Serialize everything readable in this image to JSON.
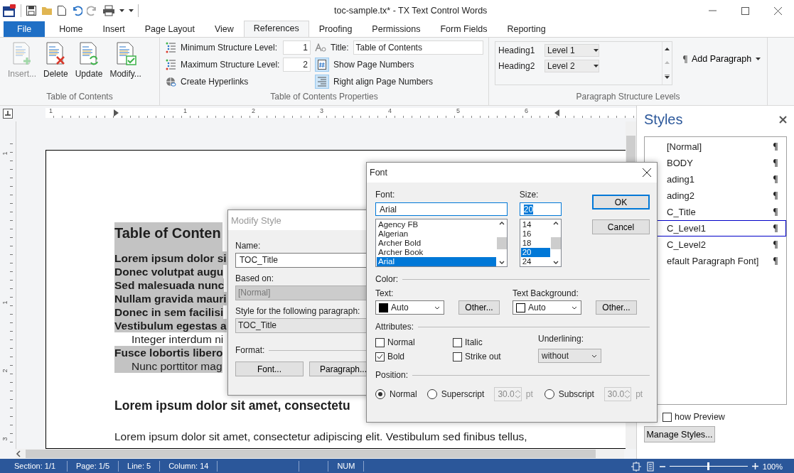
{
  "window": {
    "title": "toc-sample.tx* - TX Text Control Words"
  },
  "ribbon_tabs": [
    {
      "label": "File",
      "kind": "file",
      "selected": false
    },
    {
      "label": "Home",
      "kind": "tab",
      "selected": false
    },
    {
      "label": "Insert",
      "kind": "tab",
      "selected": false
    },
    {
      "label": "Page Layout",
      "kind": "tab",
      "selected": false
    },
    {
      "label": "View",
      "kind": "tab",
      "selected": false
    },
    {
      "label": "References",
      "kind": "tab",
      "selected": true
    },
    {
      "label": "Proofing",
      "kind": "tab",
      "selected": false
    },
    {
      "label": "Permissions",
      "kind": "tab",
      "selected": false
    },
    {
      "label": "Form Fields",
      "kind": "tab",
      "selected": false
    },
    {
      "label": "Reporting",
      "kind": "tab",
      "selected": false
    }
  ],
  "toc_group": {
    "label": "Table of Contents",
    "buttons": [
      {
        "label": "Insert...",
        "kind": "insert",
        "disabled": true
      },
      {
        "label": "Delete",
        "kind": "delete",
        "disabled": false
      },
      {
        "label": "Update",
        "kind": "update",
        "disabled": false
      },
      {
        "label": "Modify...",
        "kind": "modify",
        "disabled": false
      }
    ]
  },
  "properties_group": {
    "label": "Table of Contents Properties",
    "min_level": {
      "label": "Minimum Structure Level:",
      "value": "1"
    },
    "max_level": {
      "label": "Maximum Structure Level:",
      "value": "2"
    },
    "create_hyperlinks": {
      "label": "Create Hyperlinks"
    },
    "title": {
      "label": "Title:",
      "value": "Table of Contents"
    },
    "show_page_numbers": {
      "label": "Show Page Numbers",
      "on": true
    },
    "right_align": {
      "label": "Right align Page Numbers",
      "on": true
    }
  },
  "structure_group": {
    "label": "Paragraph Structure Levels",
    "rows": [
      {
        "style": "Heading1",
        "level": "Level 1"
      },
      {
        "style": "Heading2",
        "level": "Level 2"
      }
    ],
    "add_paragraph": {
      "label": "Add Paragraph"
    }
  },
  "ruler": {
    "horizontal": [
      "1",
      "1",
      "2",
      "3",
      "4",
      "5",
      "6"
    ],
    "vertical": [
      "1",
      "1",
      "2",
      "3"
    ]
  },
  "document": {
    "lines": [
      {
        "text": "Table of Conten",
        "kind": "toc_title",
        "highlighted": true
      },
      {
        "text": "Lorem ipsum dolor si",
        "kind": "toc_level1",
        "highlighted": true
      },
      {
        "text": "Donec volutpat augu",
        "kind": "toc_level1",
        "highlighted": true
      },
      {
        "text": "Sed malesuada nunc",
        "kind": "toc_level1",
        "highlighted": true
      },
      {
        "text": "Nullam gravida mauri",
        "kind": "toc_level1",
        "highlighted": true
      },
      {
        "text": "Donec in sem facilisi",
        "kind": "toc_level1",
        "highlighted": true
      },
      {
        "text": "Vestibulum egestas a",
        "kind": "toc_level1",
        "highlighted": true
      },
      {
        "text": "Integer interdum ni",
        "kind": "toc_level2",
        "highlighted": false
      },
      {
        "text": "Fusce lobortis libero",
        "kind": "toc_level1",
        "highlighted": true
      },
      {
        "text": "Nunc porttitor mag",
        "kind": "toc_level2",
        "highlighted": true
      },
      {
        "text": "Lorem ipsum dolor sit amet, consectetu",
        "kind": "heading",
        "highlighted": false
      },
      {
        "text": "Lorem ipsum dolor sit amet, consectetur adipiscing elit. Vestibulum sed finibus tellus,",
        "kind": "body",
        "highlighted": false
      }
    ]
  },
  "modify_style_dialog": {
    "title": "Modify Style",
    "name": {
      "label": "Name:",
      "value": "TOC_Title"
    },
    "based_on": {
      "label": "Based on:",
      "value": "[Normal]",
      "disabled": true
    },
    "following": {
      "label": "Style for the following paragraph:",
      "value": "TOC_Title"
    },
    "format_label": "Format:",
    "buttons": [
      "Font...",
      "Paragraph..."
    ]
  },
  "font_dialog": {
    "title": "Font",
    "font": {
      "label": "Font:",
      "value": "Arial",
      "options": [
        {
          "label": "Agency FB",
          "selected": false
        },
        {
          "label": "Algerian",
          "selected": false
        },
        {
          "label": "Archer Bold",
          "selected": false
        },
        {
          "label": "Archer Book",
          "selected": false
        },
        {
          "label": "Arial",
          "selected": true
        }
      ]
    },
    "size": {
      "label": "Size:",
      "value": "20",
      "options": [
        {
          "label": "14",
          "selected": false
        },
        {
          "label": "16",
          "selected": false
        },
        {
          "label": "18",
          "selected": false
        },
        {
          "label": "20",
          "selected": true
        },
        {
          "label": "24",
          "selected": false
        }
      ]
    },
    "ok": "OK",
    "cancel": "Cancel",
    "color_label": "Color:",
    "colors": [
      {
        "label": "Text:",
        "value": "Auto",
        "color": "#000000",
        "other": "Other..."
      },
      {
        "label": "Text Background:",
        "value": "Auto",
        "color": "#ffffff",
        "other": "Other..."
      }
    ],
    "attributes_label": "Attributes:",
    "attributes": [
      {
        "label": "Normal",
        "checked": false
      },
      {
        "label": "Bold",
        "checked": true
      },
      {
        "label": "Italic",
        "checked": false
      },
      {
        "label": "Strike out",
        "checked": false
      }
    ],
    "underlining": {
      "label": "Underlining:",
      "value": "without"
    },
    "position_label": "Position:",
    "positions": [
      {
        "label": "Normal",
        "selected": true
      },
      {
        "label": "Superscript",
        "selected": false,
        "amount": "30.0",
        "unit": "pt"
      },
      {
        "label": "Subscript",
        "selected": false,
        "amount": "30.0",
        "unit": "pt"
      }
    ]
  },
  "styles_panel": {
    "title": "Styles",
    "items": [
      {
        "label": "[Normal]",
        "selected": false
      },
      {
        "label": "BODY",
        "selected": false
      },
      {
        "label": "ading1",
        "selected": false
      },
      {
        "label": "ading2",
        "selected": false
      },
      {
        "label": "C_Title",
        "selected": false
      },
      {
        "label": "C_Level1",
        "selected": true
      },
      {
        "label": "C_Level2",
        "selected": false
      },
      {
        "label": "efault Paragraph Font]",
        "selected": false
      }
    ],
    "show_preview": {
      "label": "how Preview",
      "checked": false
    },
    "manage_button": "Manage Styles..."
  },
  "status_bar": {
    "fields": [
      "Section: 1/1",
      "Page: 1/5",
      "Line: 5",
      "Column: 14",
      "NUM"
    ],
    "zoom": {
      "level": 0.5,
      "label": "100%"
    }
  }
}
